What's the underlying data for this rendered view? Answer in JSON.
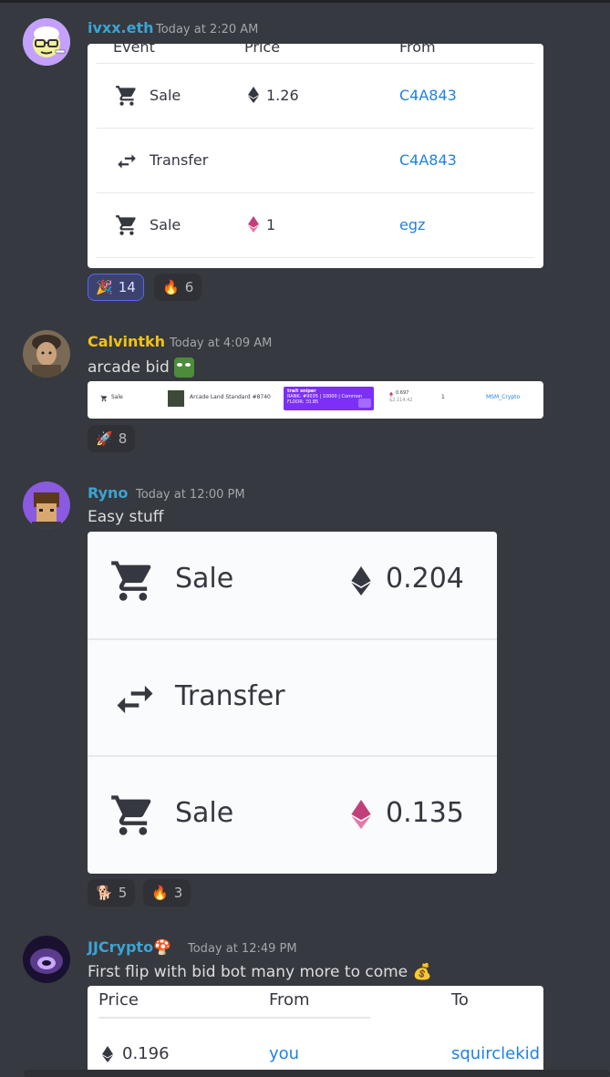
{
  "messages": [
    {
      "username": "ivxx.eth",
      "username_color": "#3ba4d4",
      "timestamp": "Today at 2:20 AM",
      "embed": {
        "headers": [
          "Event",
          "Price",
          "From"
        ],
        "rows": [
          {
            "event": "Sale",
            "price": "1.26",
            "from": "C4A843"
          },
          {
            "event": "Transfer",
            "price": "",
            "from": "C4A843"
          },
          {
            "event": "Sale",
            "price": "1",
            "from": "egz"
          }
        ]
      },
      "reactions": [
        {
          "emoji": "🎉",
          "count": "14"
        },
        {
          "emoji": "🔥",
          "count": "6"
        }
      ]
    },
    {
      "username": "Calvintkh",
      "username_color": "#f1c40f",
      "timestamp": "Today at 4:09 AM",
      "text": "arcade bid",
      "embed": {
        "event": "Sale",
        "item": "Arcade Land Standard #8740",
        "sniper_title": "trait sniper",
        "sniper_rank": "RANK: #9035 | 10000 | Common",
        "sniper_floor": "FLOOR: Ξ0.85",
        "price": "0.697",
        "usd": "$2,114.42",
        "quantity": "1",
        "from": "MSM_Crypto"
      },
      "reactions": [
        {
          "emoji": "🚀",
          "count": "8"
        }
      ]
    },
    {
      "username": "Ryno",
      "username_color": "#3ba4d4",
      "timestamp": "Today at 12:00 PM",
      "text": "Easy stuff",
      "embed": {
        "rows": [
          {
            "event": "Sale",
            "price": "0.204"
          },
          {
            "event": "Transfer",
            "price": ""
          },
          {
            "event": "Sale",
            "price": "0.135"
          }
        ]
      },
      "reactions": [
        {
          "emoji": "🐕",
          "count": "5"
        },
        {
          "emoji": "🔥",
          "count": "3"
        }
      ]
    },
    {
      "username": "JJCrypto",
      "username_badge": "🍄",
      "username_color": "#3ba4d4",
      "timestamp": "Today at 12:49 PM",
      "text": "First flip with bid bot many more to come",
      "text_emoji": "💰",
      "embed": {
        "headers": [
          "Price",
          "From",
          "To"
        ],
        "row": {
          "price": "0.196",
          "from": "you",
          "to": "squirclekid"
        }
      }
    }
  ]
}
